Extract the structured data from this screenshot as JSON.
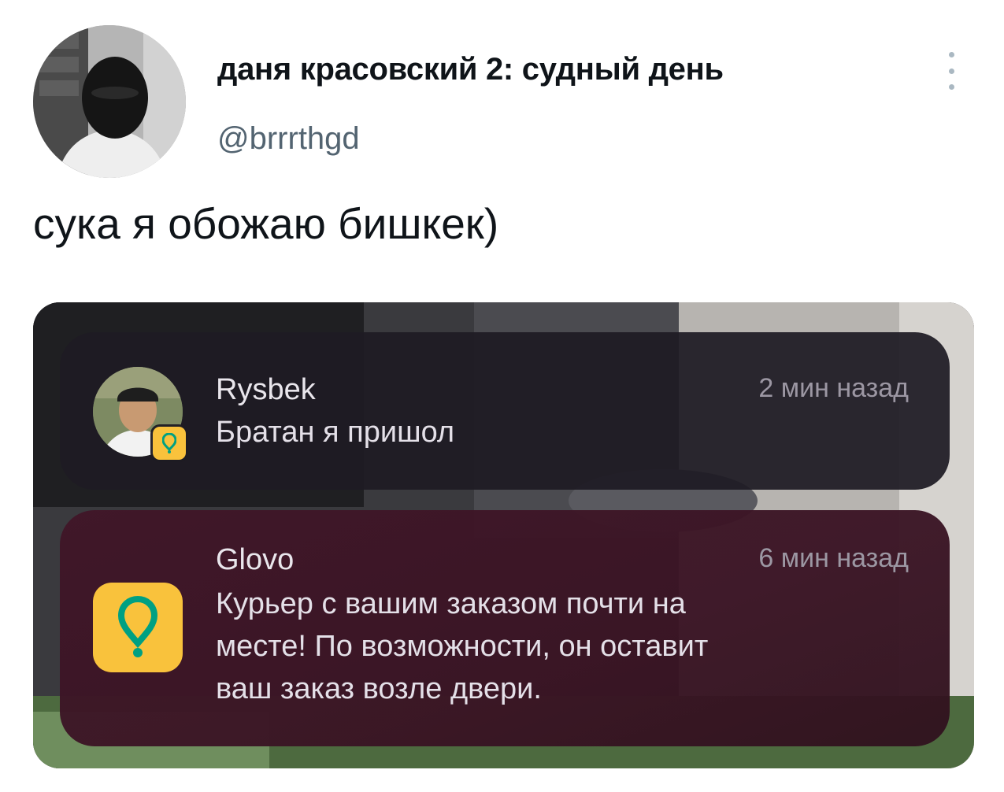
{
  "tweet": {
    "author_name": "даня красовский 2: судный день",
    "author_handle": "@brrrthgd",
    "text": "сука я обожаю бишкек)"
  },
  "notifications": [
    {
      "app": "Rysbek",
      "time": "2 мин назад",
      "body": "Братан я пришол",
      "icon": "glovo-app-icon"
    },
    {
      "app": "Glovo",
      "time": "6 мин назад",
      "body_lines": [
        "Курьер с вашим заказом почти на",
        "месте! По возможности, он оставит",
        "ваш заказ возле двери."
      ],
      "icon": "glovo-app-icon"
    }
  ],
  "colors": {
    "glovo_yellow": "#f9c23c",
    "glovo_green": "#00a082",
    "handle_gray": "#536471"
  }
}
